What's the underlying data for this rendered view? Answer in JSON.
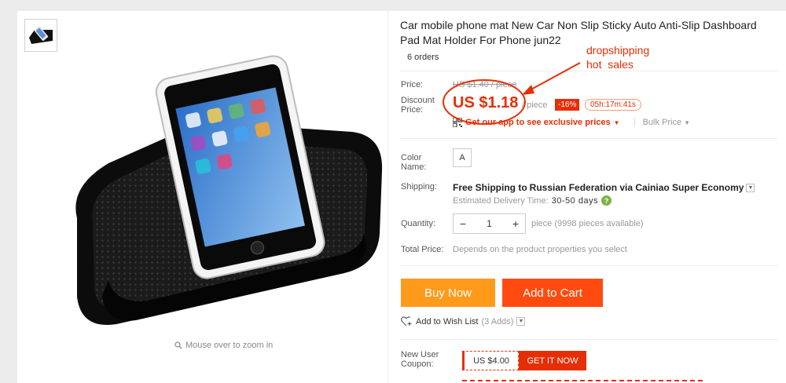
{
  "product": {
    "title": "Car mobile phone mat New Car Non Slip Sticky Auto Anti-Slip Dashboard Pad Mat Holder For Phone jun22",
    "orders": "6 orders"
  },
  "gallery": {
    "zoom_hint": "Mouse over to zoom in"
  },
  "price": {
    "price_label": "Price:",
    "original": "US $1.40 / piece",
    "discount_label": "Discount Price:",
    "discount": "US $1.18",
    "unit": "/ piece",
    "percent_off": "-16%",
    "timer": "05h:17m:41s",
    "app_promo": "Get our app to see exclusive prices",
    "bulk": "Bulk Price"
  },
  "options": {
    "color_label": "Color Name:",
    "color_value": "A"
  },
  "shipping": {
    "label": "Shipping:",
    "free": "Free Shipping to",
    "destination": "Russian Federation via Cainiao Super Economy",
    "delivery_label": "Estimated Delivery Time:",
    "delivery_days": "30-50 days"
  },
  "quantity": {
    "label": "Quantity:",
    "value": "1",
    "minus": "−",
    "plus": "+",
    "stock": "piece (9998 pieces available)"
  },
  "total": {
    "label": "Total Price:",
    "note": "Depends on the product properties you select"
  },
  "actions": {
    "buy_now": "Buy Now",
    "add_to_cart": "Add to Cart",
    "wishlist": "Add to Wish List",
    "wish_count": "(3 Adds)"
  },
  "coupon": {
    "label": "New User Coupon:",
    "amount": "US $4.00",
    "cta": "GET IT NOW"
  },
  "annotation": {
    "line1": "dropshipping",
    "line2": "hot  sales"
  },
  "colors": {
    "accent": "#e62e04",
    "buy_now": "#ff9a1b",
    "add_to_cart": "#ff4b10"
  }
}
